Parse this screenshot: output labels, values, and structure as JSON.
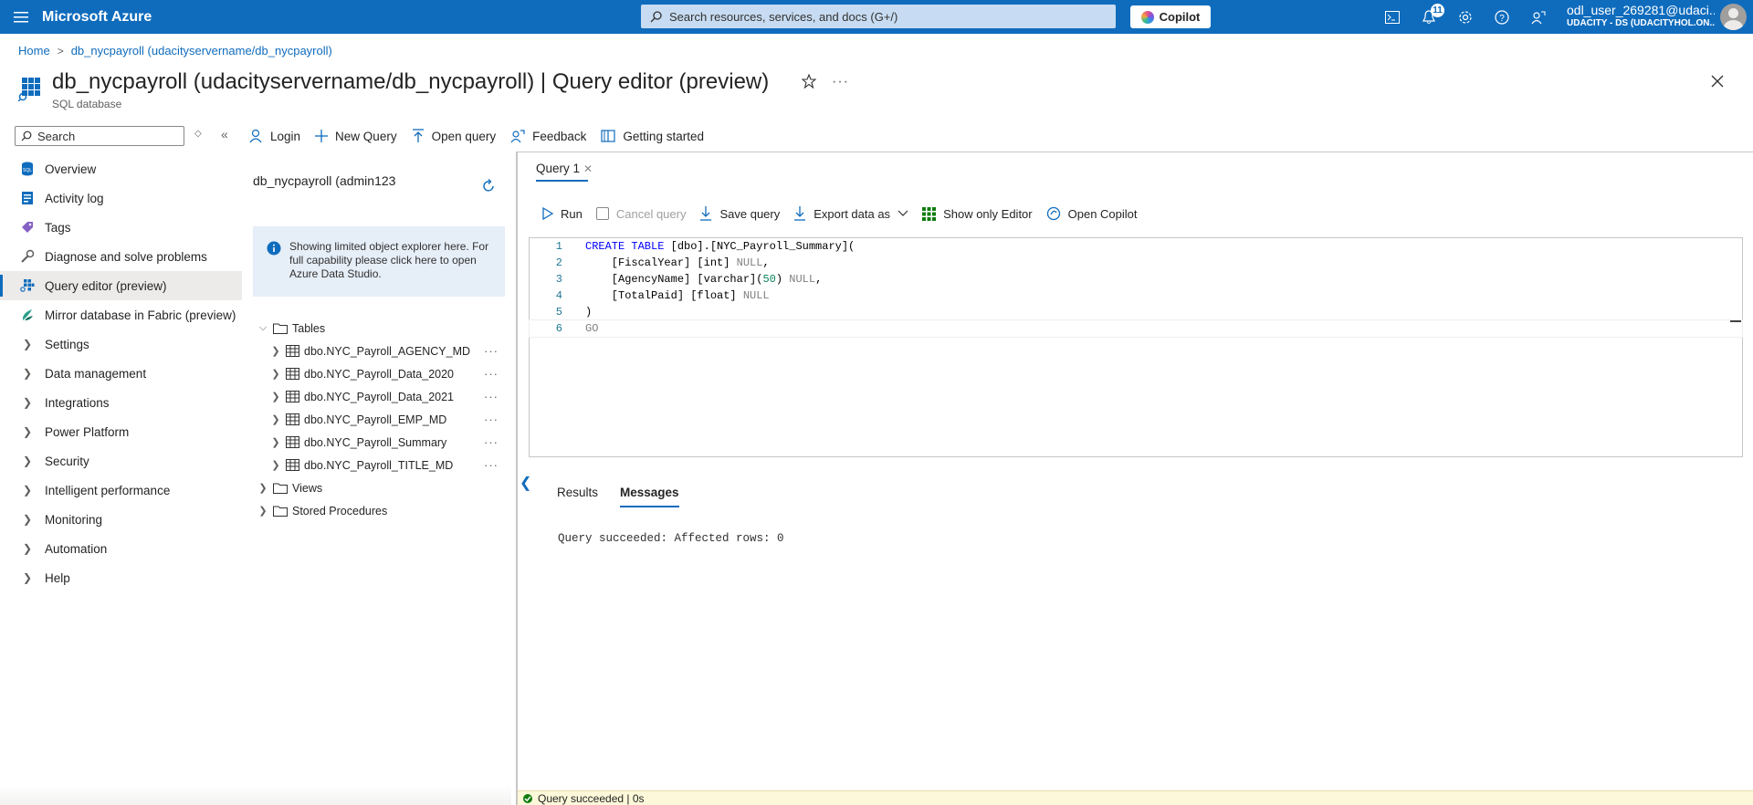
{
  "topbar": {
    "brand": "Microsoft Azure",
    "search_placeholder": "Search resources, services, and docs (G+/)",
    "copilot_label": "Copilot",
    "notifications_count": "11",
    "user_name": "odl_user_269281@udaci...",
    "user_tenant": "UDACITY - DS (UDACITYHOL.ON..."
  },
  "breadcrumb": {
    "home": "Home",
    "separator": ">",
    "current": "db_nycpayroll (udacityservername/db_nycpayroll)"
  },
  "header": {
    "title": "db_nycpayroll (udacityservername/db_nycpayroll) | Query editor (preview)",
    "subtitle": "SQL database",
    "more": "···"
  },
  "leftnav": {
    "search_placeholder": "Search",
    "items": [
      {
        "label": "Overview",
        "icon": "sql-database-icon"
      },
      {
        "label": "Activity log",
        "icon": "activity-log-icon"
      },
      {
        "label": "Tags",
        "icon": "tag-icon"
      },
      {
        "label": "Diagnose and solve problems",
        "icon": "wrench-icon"
      },
      {
        "label": "Query editor (preview)",
        "icon": "query-editor-icon",
        "active": true
      },
      {
        "label": "Mirror database in Fabric (preview)",
        "icon": "fabric-icon"
      },
      {
        "label": "Settings"
      },
      {
        "label": "Data management"
      },
      {
        "label": "Integrations"
      },
      {
        "label": "Power Platform"
      },
      {
        "label": "Security"
      },
      {
        "label": "Intelligent performance"
      },
      {
        "label": "Monitoring"
      },
      {
        "label": "Automation"
      },
      {
        "label": "Help"
      }
    ]
  },
  "toolbar": {
    "login": "Login",
    "new_query": "New Query",
    "open_query": "Open query",
    "feedback": "Feedback",
    "getting_started": "Getting started"
  },
  "object_explorer": {
    "title": "db_nycpayroll (admin123",
    "info": "Showing limited object explorer here. For full capability please click here to open Azure Data Studio.",
    "tables_label": "Tables",
    "tables": [
      "dbo.NYC_Payroll_AGENCY_MD",
      "dbo.NYC_Payroll_Data_2020",
      "dbo.NYC_Payroll_Data_2021",
      "dbo.NYC_Payroll_EMP_MD",
      "dbo.NYC_Payroll_Summary",
      "dbo.NYC_Payroll_TITLE_MD"
    ],
    "views_label": "Views",
    "procs_label": "Stored Procedures",
    "dots": "···"
  },
  "editor": {
    "tab_label": "Query 1",
    "run": "Run",
    "cancel_query": "Cancel query",
    "save_query": "Save query",
    "export_data": "Export data as",
    "show_only_editor": "Show only Editor",
    "open_copilot": "Open Copilot",
    "line_numbers": [
      "1",
      "2",
      "3",
      "4",
      "5",
      "6"
    ],
    "code": {
      "l1_kw": "CREATE TABLE",
      "l1_rest": " [dbo].[NYC_Payroll_Summary](",
      "l2_a": "    [FiscalYear] [int] ",
      "l2_b": "NULL",
      "l2_c": ",",
      "l3_a": "    [AgencyName] [varchar](",
      "l3_num": "50",
      "l3_b": ") ",
      "l3_c": "NULL",
      "l3_d": ",",
      "l4_a": "    [TotalPaid] [float] ",
      "l4_b": "NULL",
      "l5": ")",
      "l6": "GO"
    }
  },
  "results": {
    "tab_results": "Results",
    "tab_messages": "Messages",
    "message": "Query succeeded: Affected rows: 0"
  },
  "status": {
    "text": "Query succeeded | 0s"
  },
  "colors": {
    "azure_blue": "#0f6cbd",
    "status_bg": "#fcf8d9",
    "success": "#107c10"
  }
}
